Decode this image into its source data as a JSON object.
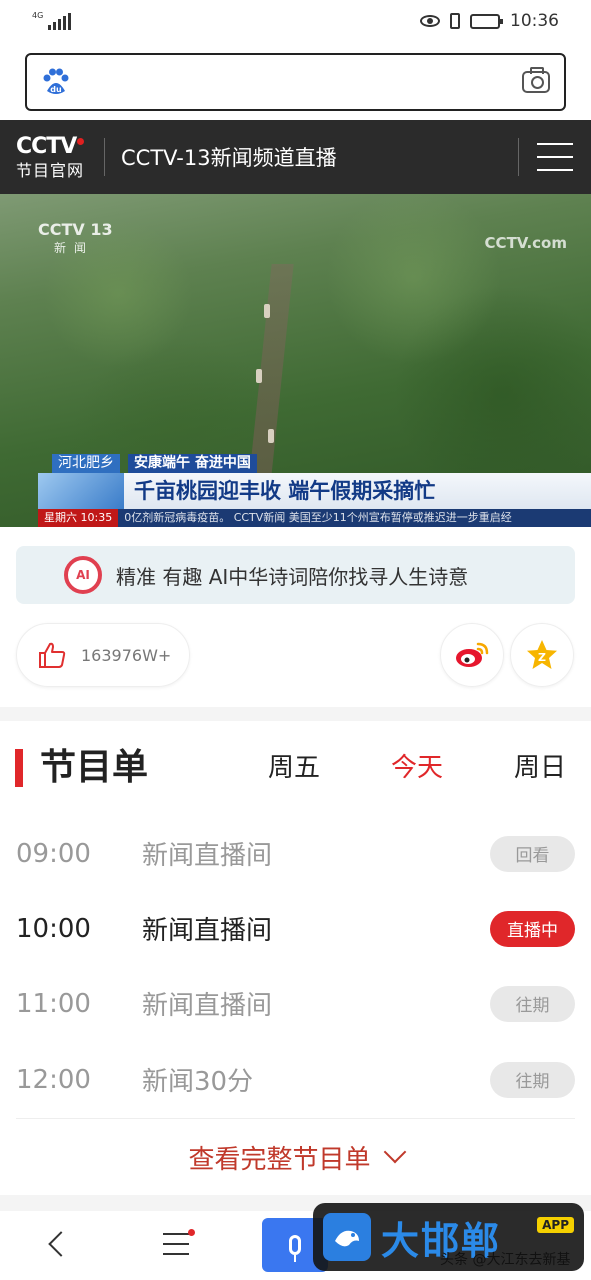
{
  "status_bar": {
    "network": "4G",
    "time": "10:36"
  },
  "search": {
    "logo_text": "du"
  },
  "header": {
    "logo_mark": "CCTV",
    "logo_sub": "节目官网",
    "channel_title": "CCTV-13新闻频道直播"
  },
  "video": {
    "watermark_left": "CCTV 13",
    "watermark_left_sub": "新闻",
    "watermark_right": "CCTV.com",
    "tag1": "河北肥乡",
    "tag2": "安康端午 奋进中国",
    "headline": "千亩桃园迎丰收 端午假期采摘忙",
    "ticker_time": "星期六 10:35",
    "ticker_text": "0亿剂新冠病毒疫苗。  CCTV新闻  美国至少11个州宣布暂停或推迟进一步重启经"
  },
  "ai_banner": {
    "icon_label": "AI",
    "text": "精准 有趣 AI中华诗词陪你找寻人生诗意"
  },
  "actions": {
    "like_count": "163976W+",
    "like_icon": "thumb-up",
    "weibo_icon": "weibo",
    "favorite_icon": "star"
  },
  "schedule": {
    "title": "节目单",
    "days": [
      "周五",
      "今天",
      "周日"
    ],
    "active_day": "今天",
    "programs": [
      {
        "time": "09:00",
        "name": "新闻直播间",
        "badge": "回看"
      },
      {
        "time": "10:00",
        "name": "新闻直播间",
        "badge": "直播中"
      },
      {
        "time": "11:00",
        "name": "新闻直播间",
        "badge": "往期"
      },
      {
        "time": "12:00",
        "name": "新闻30分",
        "badge": "往期"
      }
    ],
    "view_full": "查看完整节目单"
  },
  "bottom_nav": {
    "back_icon": "back",
    "menu_icon": "menu",
    "mic_icon": "microphone"
  },
  "overlay": {
    "brand_name": "大邯郸",
    "app_tag": "APP",
    "credit": "头条 @大江东去新基"
  },
  "colors": {
    "accent_red": "#e0272a",
    "header_bg": "#2b2b2b",
    "mic_blue": "#3a77f0",
    "brand_blue": "#2b8ae8"
  }
}
